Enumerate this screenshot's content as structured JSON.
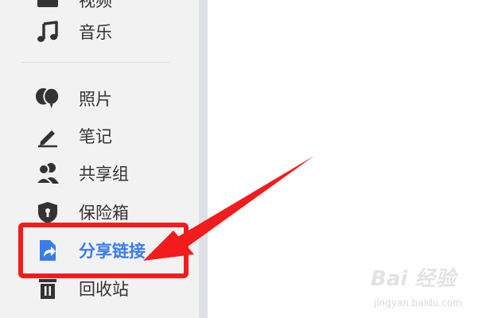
{
  "sidebar": {
    "items": [
      {
        "label": "视频",
        "icon": "video-icon"
      },
      {
        "label": "音乐",
        "icon": "music-note-icon"
      },
      {
        "label": "照片",
        "icon": "photos-icon"
      },
      {
        "label": "笔记",
        "icon": "pen-icon"
      },
      {
        "label": "共享组",
        "icon": "group-icon"
      },
      {
        "label": "保险箱",
        "icon": "shield-lock-icon"
      },
      {
        "label": "分享链接",
        "icon": "share-link-icon",
        "active": true
      },
      {
        "label": "回收站",
        "icon": "trash-icon"
      }
    ]
  },
  "colors": {
    "active_text": "#3b7ce9",
    "icon": "#333333",
    "annotation": "#f21c1c",
    "sidebar_bg": "#f2f2f3"
  },
  "watermark": {
    "brand": "Bai 经验",
    "url": "jingyan.baidu.com"
  }
}
